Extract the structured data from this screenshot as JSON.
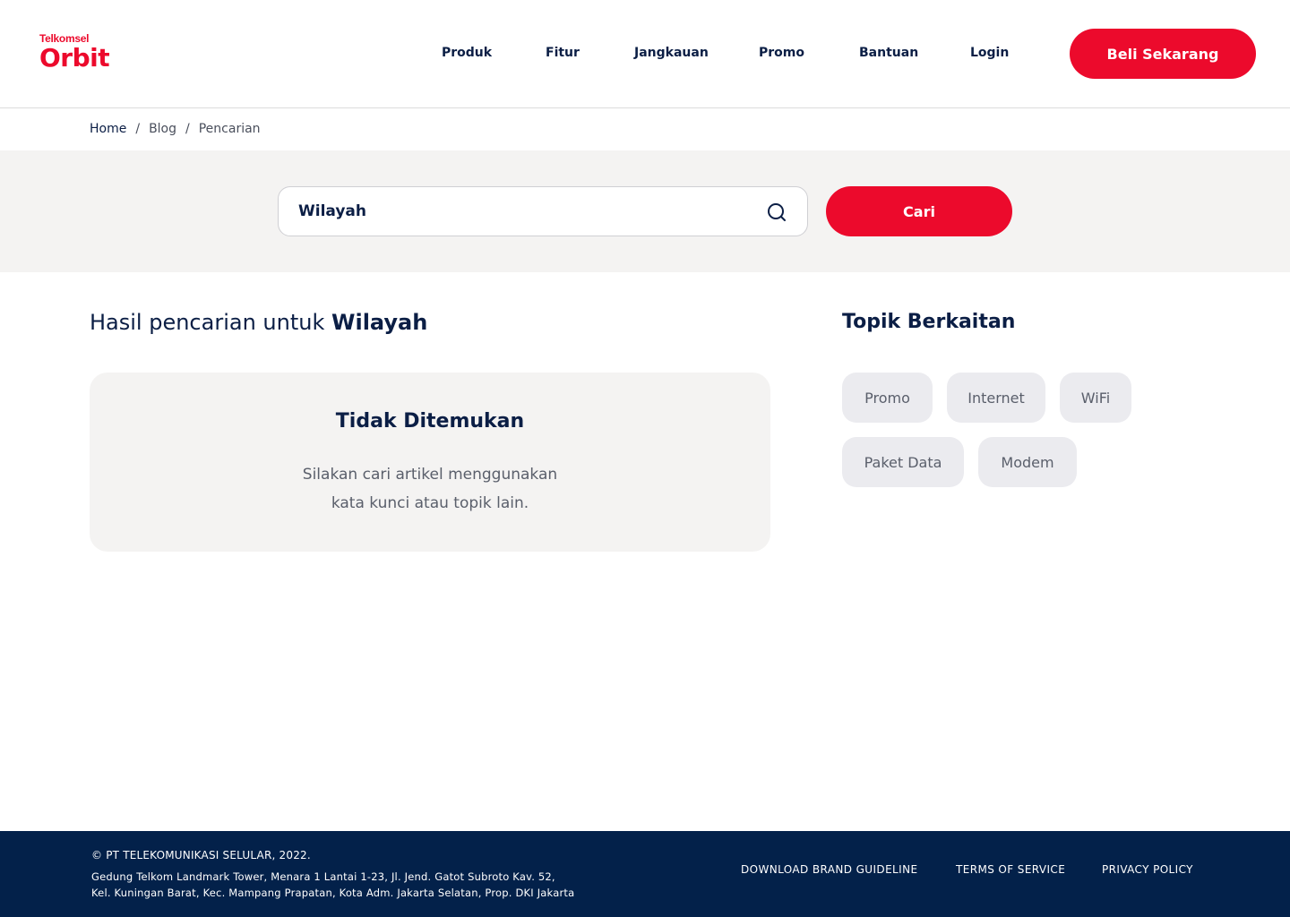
{
  "brand": {
    "logo_top": "Telkomsel",
    "logo_main": "Orbit",
    "accent_color": "#ec0a2c",
    "navy_color": "#0b1e45"
  },
  "nav": {
    "items": [
      {
        "label": "Produk"
      },
      {
        "label": "Fitur"
      },
      {
        "label": "Jangkauan"
      },
      {
        "label": "Promo"
      },
      {
        "label": "Bantuan"
      },
      {
        "label": "Login"
      }
    ],
    "cta_label": "Beli Sekarang"
  },
  "breadcrumb": {
    "home": "Home",
    "sep": "/",
    "blog": "Blog",
    "current": "Pencarian"
  },
  "search": {
    "value": "Wilayah",
    "icon": "search-icon",
    "button_label": "Cari"
  },
  "results": {
    "prefix": "Hasil pencarian untuk",
    "query": "Wilayah",
    "empty_title": "Tidak Ditemukan",
    "empty_desc_line1": "Silakan cari artikel menggunakan",
    "empty_desc_line2": "kata kunci atau topik lain."
  },
  "topics": {
    "title": "Topik Berkaitan",
    "chips": [
      {
        "label": "Promo"
      },
      {
        "label": "Internet"
      },
      {
        "label": "WiFi"
      },
      {
        "label": "Paket Data"
      },
      {
        "label": "Modem"
      }
    ]
  },
  "footer": {
    "copyright": "© PT TELEKOMUNIKASI SELULAR, 2022.",
    "address_line1": "Gedung Telkom Landmark Tower, Menara 1 Lantai 1-23, Jl. Jend. Gatot Subroto Kav. 52,",
    "address_line2": "Kel. Kuningan Barat, Kec. Mampang Prapatan, Kota Adm. Jakarta Selatan, Prop. DKI Jakarta",
    "links": [
      {
        "label": "DOWNLOAD BRAND GUIDELINE"
      },
      {
        "label": "TERMS OF SERVICE"
      },
      {
        "label": "PRIVACY POLICY"
      }
    ]
  }
}
